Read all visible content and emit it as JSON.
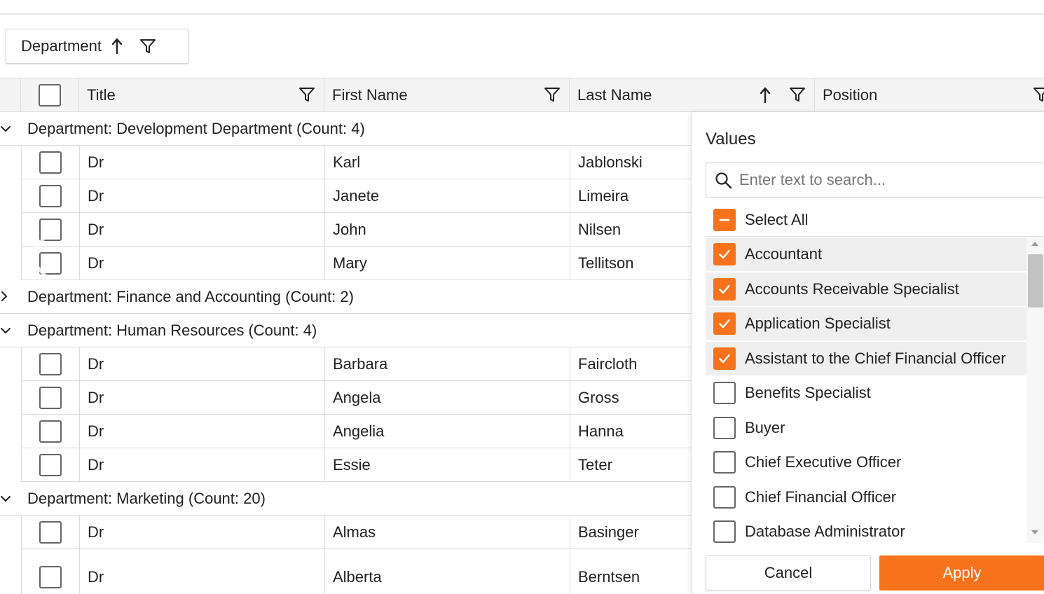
{
  "group_panel": {
    "chip_label": "Department"
  },
  "columns": {
    "title": "Title",
    "first_name": "First Name",
    "last_name": "Last Name",
    "position": "Position"
  },
  "groups": [
    {
      "label": "Department: Development Department (Count: 4)",
      "expanded": true,
      "rows": [
        {
          "title": "Dr",
          "first": "Karl",
          "last": "Jablonski"
        },
        {
          "title": "Dr",
          "first": "Janete",
          "last": "Limeira"
        },
        {
          "title": "Dr",
          "first": "John",
          "last": "Nilsen"
        },
        {
          "title": "Dr",
          "first": "Mary",
          "last": "Tellitson"
        }
      ]
    },
    {
      "label": "Department: Finance and Accounting (Count: 2)",
      "expanded": false,
      "rows": []
    },
    {
      "label": "Department: Human Resources (Count: 4)",
      "expanded": true,
      "rows": [
        {
          "title": "Dr",
          "first": "Barbara",
          "last": "Faircloth"
        },
        {
          "title": "Dr",
          "first": "Angela",
          "last": "Gross"
        },
        {
          "title": "Dr",
          "first": "Angelia",
          "last": "Hanna"
        },
        {
          "title": "Dr",
          "first": "Essie",
          "last": "Teter"
        }
      ]
    },
    {
      "label": "Department: Marketing (Count: 20)",
      "expanded": true,
      "rows": [
        {
          "title": "Dr",
          "first": "Almas",
          "last": "Basinger"
        },
        {
          "title": "Dr",
          "first": "Alberta",
          "last": "Berntsen"
        }
      ]
    }
  ],
  "filter_popup": {
    "title": "Values",
    "search_placeholder": "Enter text to search...",
    "select_all_label": "Select All",
    "values": [
      {
        "label": "Accountant",
        "checked": true
      },
      {
        "label": "Accounts Receivable Specialist",
        "checked": true
      },
      {
        "label": "Application Specialist",
        "checked": true
      },
      {
        "label": "Assistant to the Chief Financial Officer",
        "checked": true
      },
      {
        "label": "Benefits Specialist",
        "checked": false
      },
      {
        "label": "Buyer",
        "checked": false
      },
      {
        "label": "Chief Executive Officer",
        "checked": false
      },
      {
        "label": "Chief Financial Officer",
        "checked": false
      },
      {
        "label": "Database Administrator",
        "checked": false
      }
    ],
    "cancel_label": "Cancel",
    "apply_label": "Apply"
  },
  "colors": {
    "accent": "#f7731b",
    "header_bg": "#f4f4f4",
    "border": "#dcdcdc"
  }
}
